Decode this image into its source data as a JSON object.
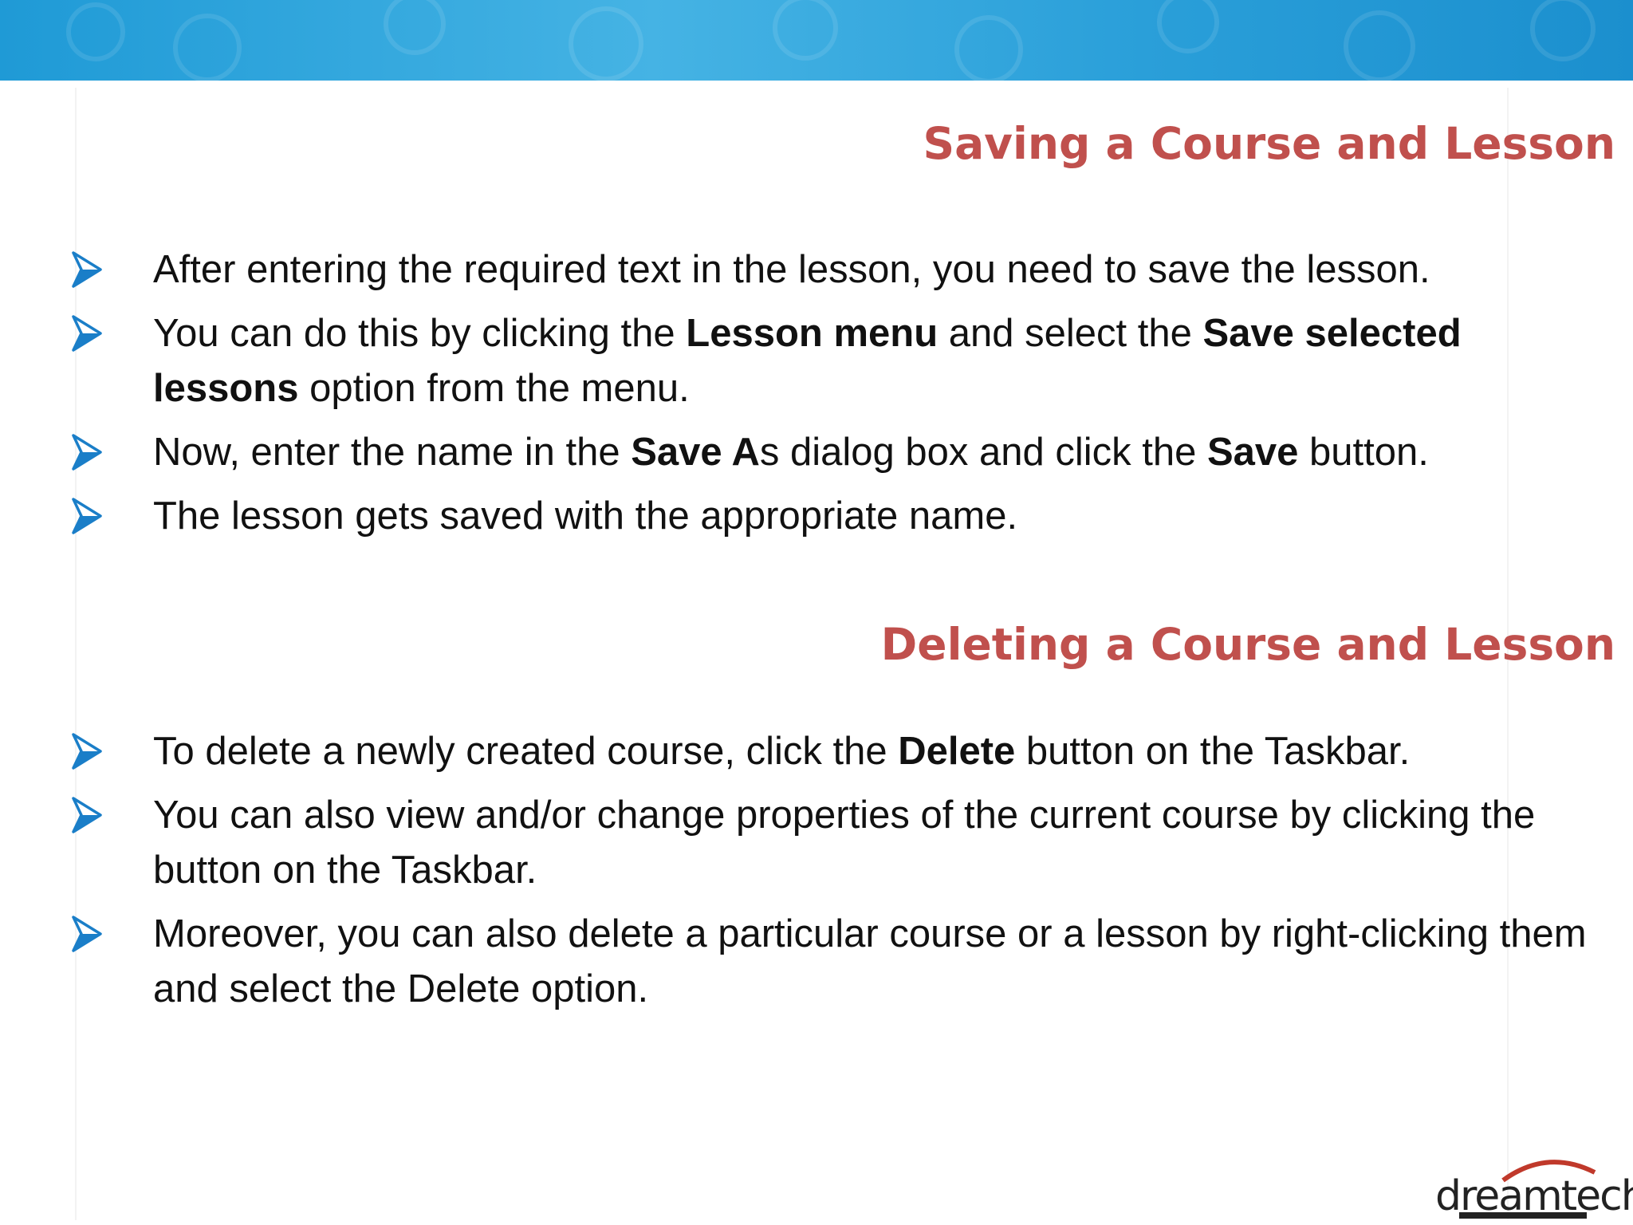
{
  "colors": {
    "accent_heading": "#c0504d",
    "band": "#2a9fd9",
    "bullet_arrow": "#1a7ec8"
  },
  "sections": [
    {
      "heading": "Saving a Course and Lesson",
      "bullets": [
        {
          "segments": [
            {
              "t": "After entering the required text in the lesson, you need to save the lesson.",
              "b": false
            }
          ]
        },
        {
          "segments": [
            {
              "t": "You can do this by clicking the ",
              "b": false
            },
            {
              "t": "Lesson menu",
              "b": true
            },
            {
              "t": " and select the ",
              "b": false
            },
            {
              "t": "Save selected lessons",
              "b": true
            },
            {
              "t": " option from the menu.",
              "b": false
            }
          ]
        },
        {
          "segments": [
            {
              "t": "Now, enter the name in the ",
              "b": false
            },
            {
              "t": "Save A",
              "b": true
            },
            {
              "t": "s dialog box and click the ",
              "b": false
            },
            {
              "t": "Save",
              "b": true
            },
            {
              "t": " button.",
              "b": false
            }
          ]
        },
        {
          "segments": [
            {
              "t": "The lesson gets saved with the appropriate name.",
              "b": false
            }
          ]
        }
      ]
    },
    {
      "heading": "Deleting a Course and Lesson",
      "bullets": [
        {
          "segments": [
            {
              "t": "To delete a newly created course, click the ",
              "b": false
            },
            {
              "t": "Delete",
              "b": true
            },
            {
              "t": " button on the Taskbar.",
              "b": false
            }
          ]
        },
        {
          "segments": [
            {
              "t": "You can also view and/or change properties of the current course by clicking the button on the Taskbar.",
              "b": false
            }
          ]
        },
        {
          "segments": [
            {
              "t": "Moreover, you can also delete a particular course or a lesson by right-clicking them and select the Delete option.",
              "b": false
            }
          ]
        }
      ]
    }
  ],
  "logo": {
    "text": "dreamtech",
    "icon": "dreamtech-logo"
  }
}
